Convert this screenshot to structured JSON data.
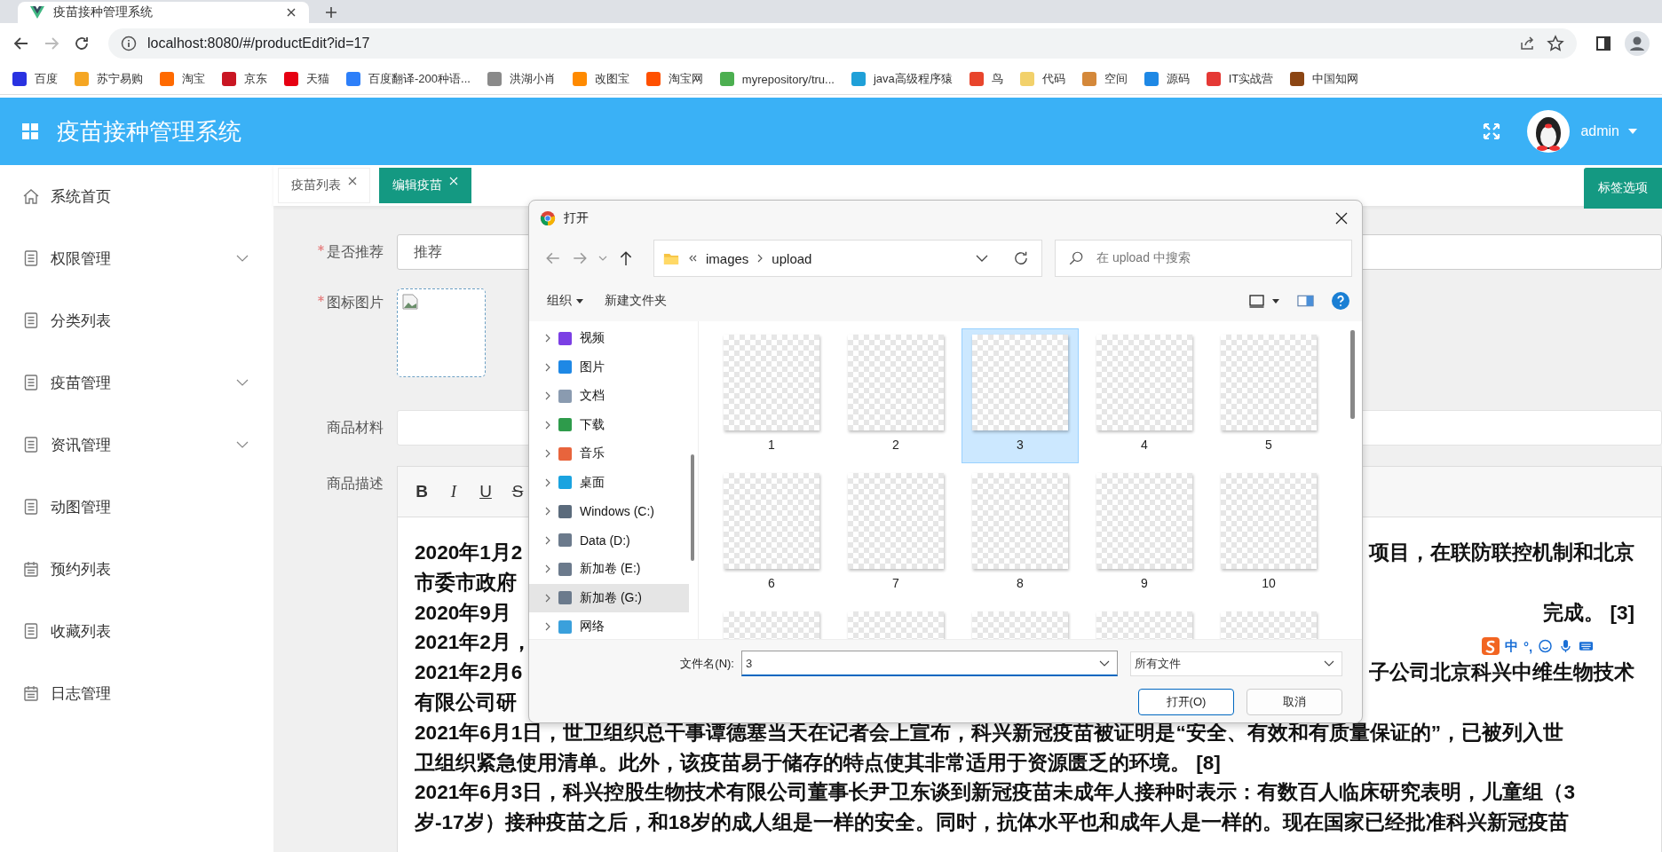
{
  "browser": {
    "tab_title": "疫苗接种管理系统",
    "url": "localhost:8080/#/productEdit?id=17",
    "bookmarks": [
      {
        "label": "百度",
        "color": "#2932e1"
      },
      {
        "label": "苏宁易购",
        "color": "#f5a623"
      },
      {
        "label": "淘宝",
        "color": "#ff6a00"
      },
      {
        "label": "京东",
        "color": "#c91623"
      },
      {
        "label": "天猫",
        "color": "#e60012"
      },
      {
        "label": "百度翻译-200种语...",
        "color": "#2d7ff9"
      },
      {
        "label": "洪湖小肖",
        "color": "#8a8a8a"
      },
      {
        "label": "改图宝",
        "color": "#ff8a00"
      },
      {
        "label": "淘宝网",
        "color": "#ff5000"
      },
      {
        "label": "myrepository/tru...",
        "color": "#4caf50"
      },
      {
        "label": "java高级程序猿",
        "color": "#1fa0d8"
      },
      {
        "label": "鸟",
        "color": "#e8452c"
      },
      {
        "label": "代码",
        "color": "#f2d16b"
      },
      {
        "label": "空间",
        "color": "#d4883a"
      },
      {
        "label": "源码",
        "color": "#1e88e5"
      },
      {
        "label": "IT实战营",
        "color": "#e53935"
      },
      {
        "label": "中国知网",
        "color": "#8b4513"
      }
    ]
  },
  "header": {
    "title": "疫苗接种管理系统",
    "user": "admin"
  },
  "sidebar": {
    "items": [
      {
        "label": "系统首页",
        "kind": "home",
        "has_submenu": false
      },
      {
        "label": "权限管理",
        "kind": "doc",
        "has_submenu": true
      },
      {
        "label": "分类列表",
        "kind": "doc",
        "has_submenu": false
      },
      {
        "label": "疫苗管理",
        "kind": "doc",
        "has_submenu": true
      },
      {
        "label": "资讯管理",
        "kind": "doc",
        "has_submenu": true
      },
      {
        "label": "动图管理",
        "kind": "doc",
        "has_submenu": false
      },
      {
        "label": "预约列表",
        "kind": "calendar",
        "has_submenu": false
      },
      {
        "label": "收藏列表",
        "kind": "doc",
        "has_submenu": false
      },
      {
        "label": "日志管理",
        "kind": "calendar",
        "has_submenu": false
      }
    ]
  },
  "tabs": [
    {
      "label": "疫苗列表",
      "selected": false
    },
    {
      "label": "编辑疫苗",
      "selected": true
    }
  ],
  "tab_options_button": "标签选项",
  "form": {
    "recommend": {
      "label": "是否推荐",
      "required": true,
      "value": "推荐"
    },
    "icon_image": {
      "label": "图标图片",
      "required": true
    },
    "material": {
      "label": "商品材料",
      "required": false
    },
    "description": {
      "label": "商品描述",
      "required": false,
      "toolbar": [
        {
          "label": "B",
          "kind": "bold"
        },
        {
          "label": "I",
          "kind": "italic"
        },
        {
          "label": "U",
          "kind": "underline"
        },
        {
          "label": "S",
          "kind": "strike"
        }
      ],
      "lines": [
        {
          "kind": "split",
          "left": "2020年1月2",
          "right": "项目，在联防联控机制和北京"
        },
        {
          "kind": "split",
          "left": "市委市政府"
        },
        {
          "kind": "split",
          "left": "2020年9月",
          "right": "完成。 [3]"
        },
        {
          "kind": "split",
          "left": "2021年2月，"
        },
        {
          "kind": "split",
          "left": "2021年2月6",
          "right": "子公司北京科兴中维生物技术"
        },
        {
          "kind": "split",
          "left": "有限公司研"
        },
        {
          "kind": "full",
          "text": "2021年6月1日，世卫组织总干事谭德塞当天在记者会上宣布，科兴新冠疫苗被证明是“安全、有效和有质量保证的”，已被列入世"
        },
        {
          "kind": "full",
          "text": "卫组织紧急使用清单。此外，该疫苗易于储存的特点使其非常适用于资源匮乏的环境。 [8]"
        },
        {
          "kind": "full",
          "text": "2021年6月3日，科兴控股生物技术有限公司董事长尹卫东谈到新冠疫苗未成年人接种时表示：有数百人临床研究表明，儿童组（3"
        },
        {
          "kind": "full",
          "text": "岁-17岁）接种疫苗之后，和18岁的成人组是一样的安全。同时，抗体水平也和成年人是一样的。现在国家已经批准科兴新冠疫苗"
        }
      ]
    }
  },
  "file_dialog": {
    "title": "打开",
    "path": [
      "images",
      "upload"
    ],
    "search_placeholder": "在 upload 中搜索",
    "toolbar": {
      "organize": "组织",
      "new_folder": "新建文件夹"
    },
    "nav": [
      {
        "label": "视频",
        "color": "#7b3fe4",
        "selected": false
      },
      {
        "label": "图片",
        "color": "#1e88e5",
        "selected": false
      },
      {
        "label": "文档",
        "color": "#8a9bb0",
        "selected": false
      },
      {
        "label": "下载",
        "color": "#2e9b4b",
        "selected": false
      },
      {
        "label": "音乐",
        "color": "#e8643c",
        "selected": false
      },
      {
        "label": "桌面",
        "color": "#1aa3e0",
        "selected": false
      },
      {
        "label": "Windows (C:)",
        "color": "#5b6b7c",
        "selected": false
      },
      {
        "label": "Data (D:)",
        "color": "#6b7a8c",
        "selected": false
      },
      {
        "label": "新加卷 (E:)",
        "color": "#6b7a8c",
        "selected": false
      },
      {
        "label": "新加卷 (G:)",
        "color": "#6b7a8c",
        "selected": true
      },
      {
        "label": "网络",
        "color": "#3aa0dc",
        "selected": false
      }
    ],
    "files": [
      {
        "label": "1",
        "selected": false
      },
      {
        "label": "2",
        "selected": false
      },
      {
        "label": "3",
        "selected": true
      },
      {
        "label": "4",
        "selected": false
      },
      {
        "label": "5",
        "selected": false
      },
      {
        "label": "6",
        "selected": false
      },
      {
        "label": "7",
        "selected": false
      },
      {
        "label": "8",
        "selected": false
      },
      {
        "label": "9",
        "selected": false
      },
      {
        "label": "10",
        "selected": false
      },
      {
        "selected": false
      },
      {
        "selected": false
      },
      {
        "selected": false
      },
      {
        "selected": false
      },
      {
        "selected": false
      }
    ],
    "filename_label": "文件名(N):",
    "filename_value": "3",
    "filetype": "所有文件",
    "open_button": "打开(O)",
    "cancel_button": "取消"
  },
  "ime_bar": {
    "mode": "中",
    "punct": "°,"
  }
}
